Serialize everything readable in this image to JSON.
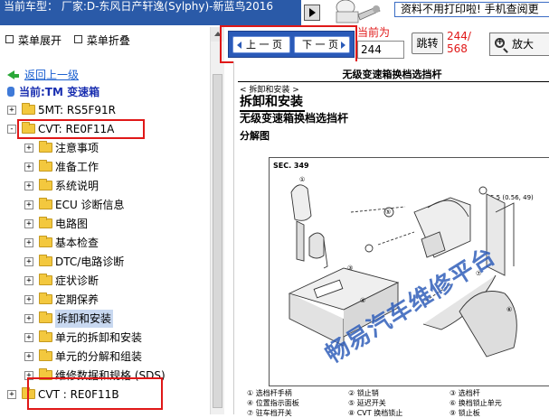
{
  "header": {
    "car_info": "当前车型：  厂家:D-东风日产轩逸(Sylphy)-新蓝鸟2016",
    "notice": "资料不用打印啦! 手机查阅更"
  },
  "menu": {
    "expand_label": "菜单展开",
    "collapse_label": "菜单折叠",
    "back_label": "返回上一级",
    "current_label": "当前:TM 变速箱"
  },
  "tree": [
    {
      "label": "5MT: RS5F91R",
      "level": 0,
      "sign": "+"
    },
    {
      "label": "CVT: RE0F11A",
      "level": 0,
      "sign": "-"
    },
    {
      "label": "注意事项",
      "level": 1,
      "sign": "+"
    },
    {
      "label": "准备工作",
      "level": 1,
      "sign": "+"
    },
    {
      "label": "系统说明",
      "level": 1,
      "sign": "+"
    },
    {
      "label": "ECU 诊断信息",
      "level": 1,
      "sign": "+"
    },
    {
      "label": "电路图",
      "level": 1,
      "sign": "+"
    },
    {
      "label": "基本检查",
      "level": 1,
      "sign": "+"
    },
    {
      "label": "DTC/电路诊断",
      "level": 1,
      "sign": "+"
    },
    {
      "label": "症状诊断",
      "level": 1,
      "sign": "+"
    },
    {
      "label": "定期保养",
      "level": 1,
      "sign": "+"
    },
    {
      "label": "拆卸和安装",
      "level": 1,
      "sign": "+",
      "selected": true
    },
    {
      "label": "单元的拆卸和安装",
      "level": 1,
      "sign": "+"
    },
    {
      "label": "单元的分解和组装",
      "level": 1,
      "sign": "+"
    },
    {
      "label": "维修数据和规格 (SDS)",
      "level": 1,
      "sign": "+"
    },
    {
      "label": "CVT : RE0F11B",
      "level": 0,
      "sign": "+"
    }
  ],
  "nav": {
    "prev_label": "上 一 页",
    "next_label": "下 一 页",
    "current_page_label": "当前为",
    "page_value": "244",
    "jump_label": "跳转",
    "total_pages": "244/\n568",
    "zoom_label": "放大"
  },
  "document": {
    "header": "无级变速箱换档选挡杆",
    "breadcrumb": "< 拆卸和安装 >",
    "section_title": "拆卸和安装",
    "subtitle": "无级变速箱换档选挡杆",
    "explode_label": "分解图",
    "sec_label": "SEC. 349",
    "torque": "5.5 (0.56, 49)",
    "watermark": "畅易汽车维修平台",
    "legend": [
      {
        "num": "①",
        "text": "选档杆手柄"
      },
      {
        "num": "②",
        "text": "锁止销"
      },
      {
        "num": "③",
        "text": "选档杆"
      },
      {
        "num": "④",
        "text": "位置指示面板"
      },
      {
        "num": "⑤",
        "text": "延迟开关"
      },
      {
        "num": "⑥",
        "text": "换档锁止单元"
      },
      {
        "num": "⑦",
        "text": "驻车档开关"
      },
      {
        "num": "⑧",
        "text": "CVT 换档锁止"
      },
      {
        "num": "⑨",
        "text": "锁止板"
      }
    ]
  },
  "colors": {
    "accent_blue": "#2a5ab8",
    "highlight_red": "#e01818",
    "folder_yellow": "#f3c83e",
    "link_blue": "#1a5fd0",
    "back_arrow_green": "#2aa838"
  }
}
